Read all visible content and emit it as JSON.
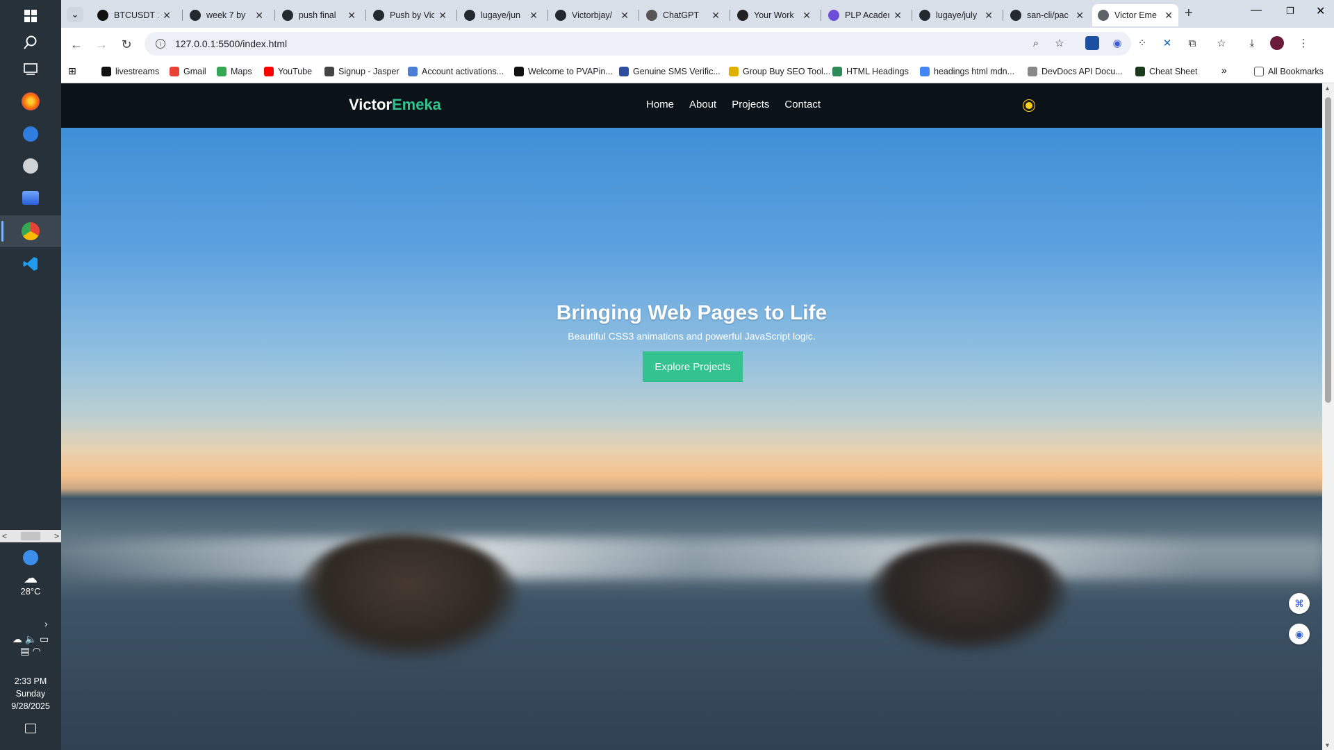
{
  "taskbar": {
    "weather_temp": "28°C",
    "clock_time": "2:33 PM",
    "clock_day": "Sunday",
    "clock_date": "9/28/2025"
  },
  "tabs": [
    {
      "label": "BTCUSDT 1",
      "favicon_color": "#111111"
    },
    {
      "label": "week 7 by",
      "favicon_color": "#24292f"
    },
    {
      "label": "push final",
      "favicon_color": "#24292f"
    },
    {
      "label": "Push by Vic",
      "favicon_color": "#24292f"
    },
    {
      "label": "lugaye/jun",
      "favicon_color": "#24292f"
    },
    {
      "label": "Victorbjay/",
      "favicon_color": "#24292f"
    },
    {
      "label": "ChatGPT",
      "favicon_color": "#555555"
    },
    {
      "label": "Your Work",
      "favicon_color": "#222222"
    },
    {
      "label": "PLP Acader",
      "favicon_color": "#6b4fd8"
    },
    {
      "label": "lugaye/july",
      "favicon_color": "#24292f"
    },
    {
      "label": "san-cli/pac",
      "favicon_color": "#24292f"
    },
    {
      "label": "Victor Eme",
      "favicon_color": "#5f6368",
      "active": true
    }
  ],
  "address_bar": {
    "url": "127.0.0.1:5500/index.html"
  },
  "bookmarks": [
    {
      "label": "livestreams",
      "color": "#111111"
    },
    {
      "label": "Gmail",
      "color": "#ea4335"
    },
    {
      "label": "Maps",
      "color": "#34a853"
    },
    {
      "label": "YouTube",
      "color": "#ff0000"
    },
    {
      "label": "Signup - Jasper",
      "color": "#444444"
    },
    {
      "label": "Account activations...",
      "color": "#4a7fd4"
    },
    {
      "label": "Welcome to PVAPin...",
      "color": "#111111"
    },
    {
      "label": "Genuine SMS Verific...",
      "color": "#2d4f9e"
    },
    {
      "label": "Group Buy SEO Tool...",
      "color": "#e0b000"
    },
    {
      "label": "HTML Headings",
      "color": "#2e8b57"
    },
    {
      "label": "headings html mdn...",
      "color": "#4285f4"
    },
    {
      "label": "DevDocs API Docu...",
      "color": "#888888"
    },
    {
      "label": "Cheat Sheet",
      "color": "#1b3a1b"
    }
  ],
  "all_bookmarks_label": "All Bookmarks",
  "site": {
    "logo_main": "Victor",
    "logo_accent": "Emeka",
    "nav": [
      "Home",
      "About",
      "Projects",
      "Contact"
    ],
    "hero_title": "Bringing Web Pages to Life",
    "hero_subtitle": "Beautiful CSS3 animations and powerful JavaScript logic.",
    "cta_label": "Explore Projects",
    "accent_color": "#34c38f",
    "nav_bg": "#0b1218"
  }
}
